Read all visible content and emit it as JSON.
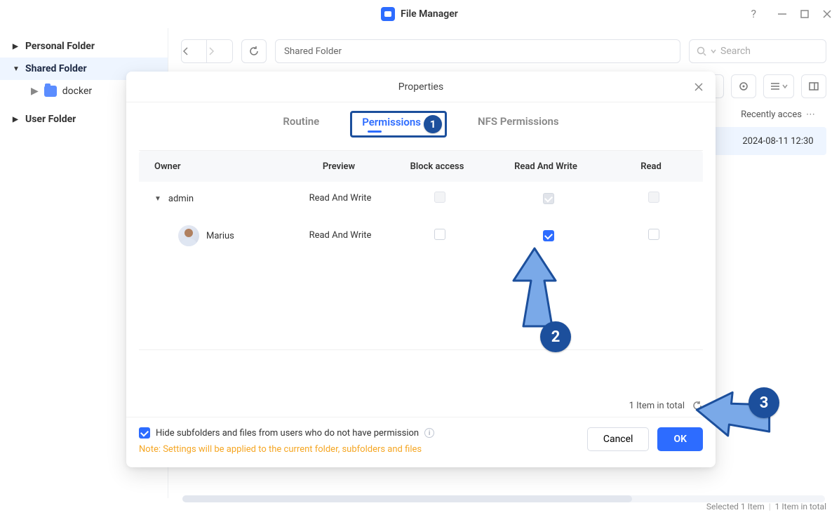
{
  "app": {
    "title": "File Manager"
  },
  "window": {
    "help": "?"
  },
  "sidebar": {
    "items": [
      {
        "label": "Personal Folder"
      },
      {
        "label": "Shared Folder"
      },
      {
        "label": "User Folder"
      }
    ],
    "sub": {
      "docker": "docker"
    }
  },
  "toolbar": {
    "path": "Shared Folder",
    "search_placeholder": "Search"
  },
  "list": {
    "header_recent": "Recently acces",
    "row_date": "2024-08-11 12:30"
  },
  "modal": {
    "title": "Properties",
    "tabs": {
      "routine": "Routine",
      "permissions": "Permissions",
      "nfs": "NFS Permissions"
    },
    "columns": {
      "owner": "Owner",
      "preview": "Preview",
      "block": "Block access",
      "rw": "Read And Write",
      "read": "Read"
    },
    "rows": [
      {
        "name": "admin",
        "preview": "Read And Write"
      },
      {
        "name": "Marius",
        "preview": "Read And Write"
      }
    ],
    "total": "1 Item in total",
    "hide_label": "Hide subfolders and files from users who do not have permission",
    "note": "Note: Settings will be applied to the current folder, subfolders and files",
    "cancel": "Cancel",
    "ok": "OK"
  },
  "status": {
    "selected": "Selected 1 Item",
    "total": "1 Item in total"
  },
  "annotations": {
    "b1": "1",
    "b2": "2",
    "b3": "3"
  }
}
